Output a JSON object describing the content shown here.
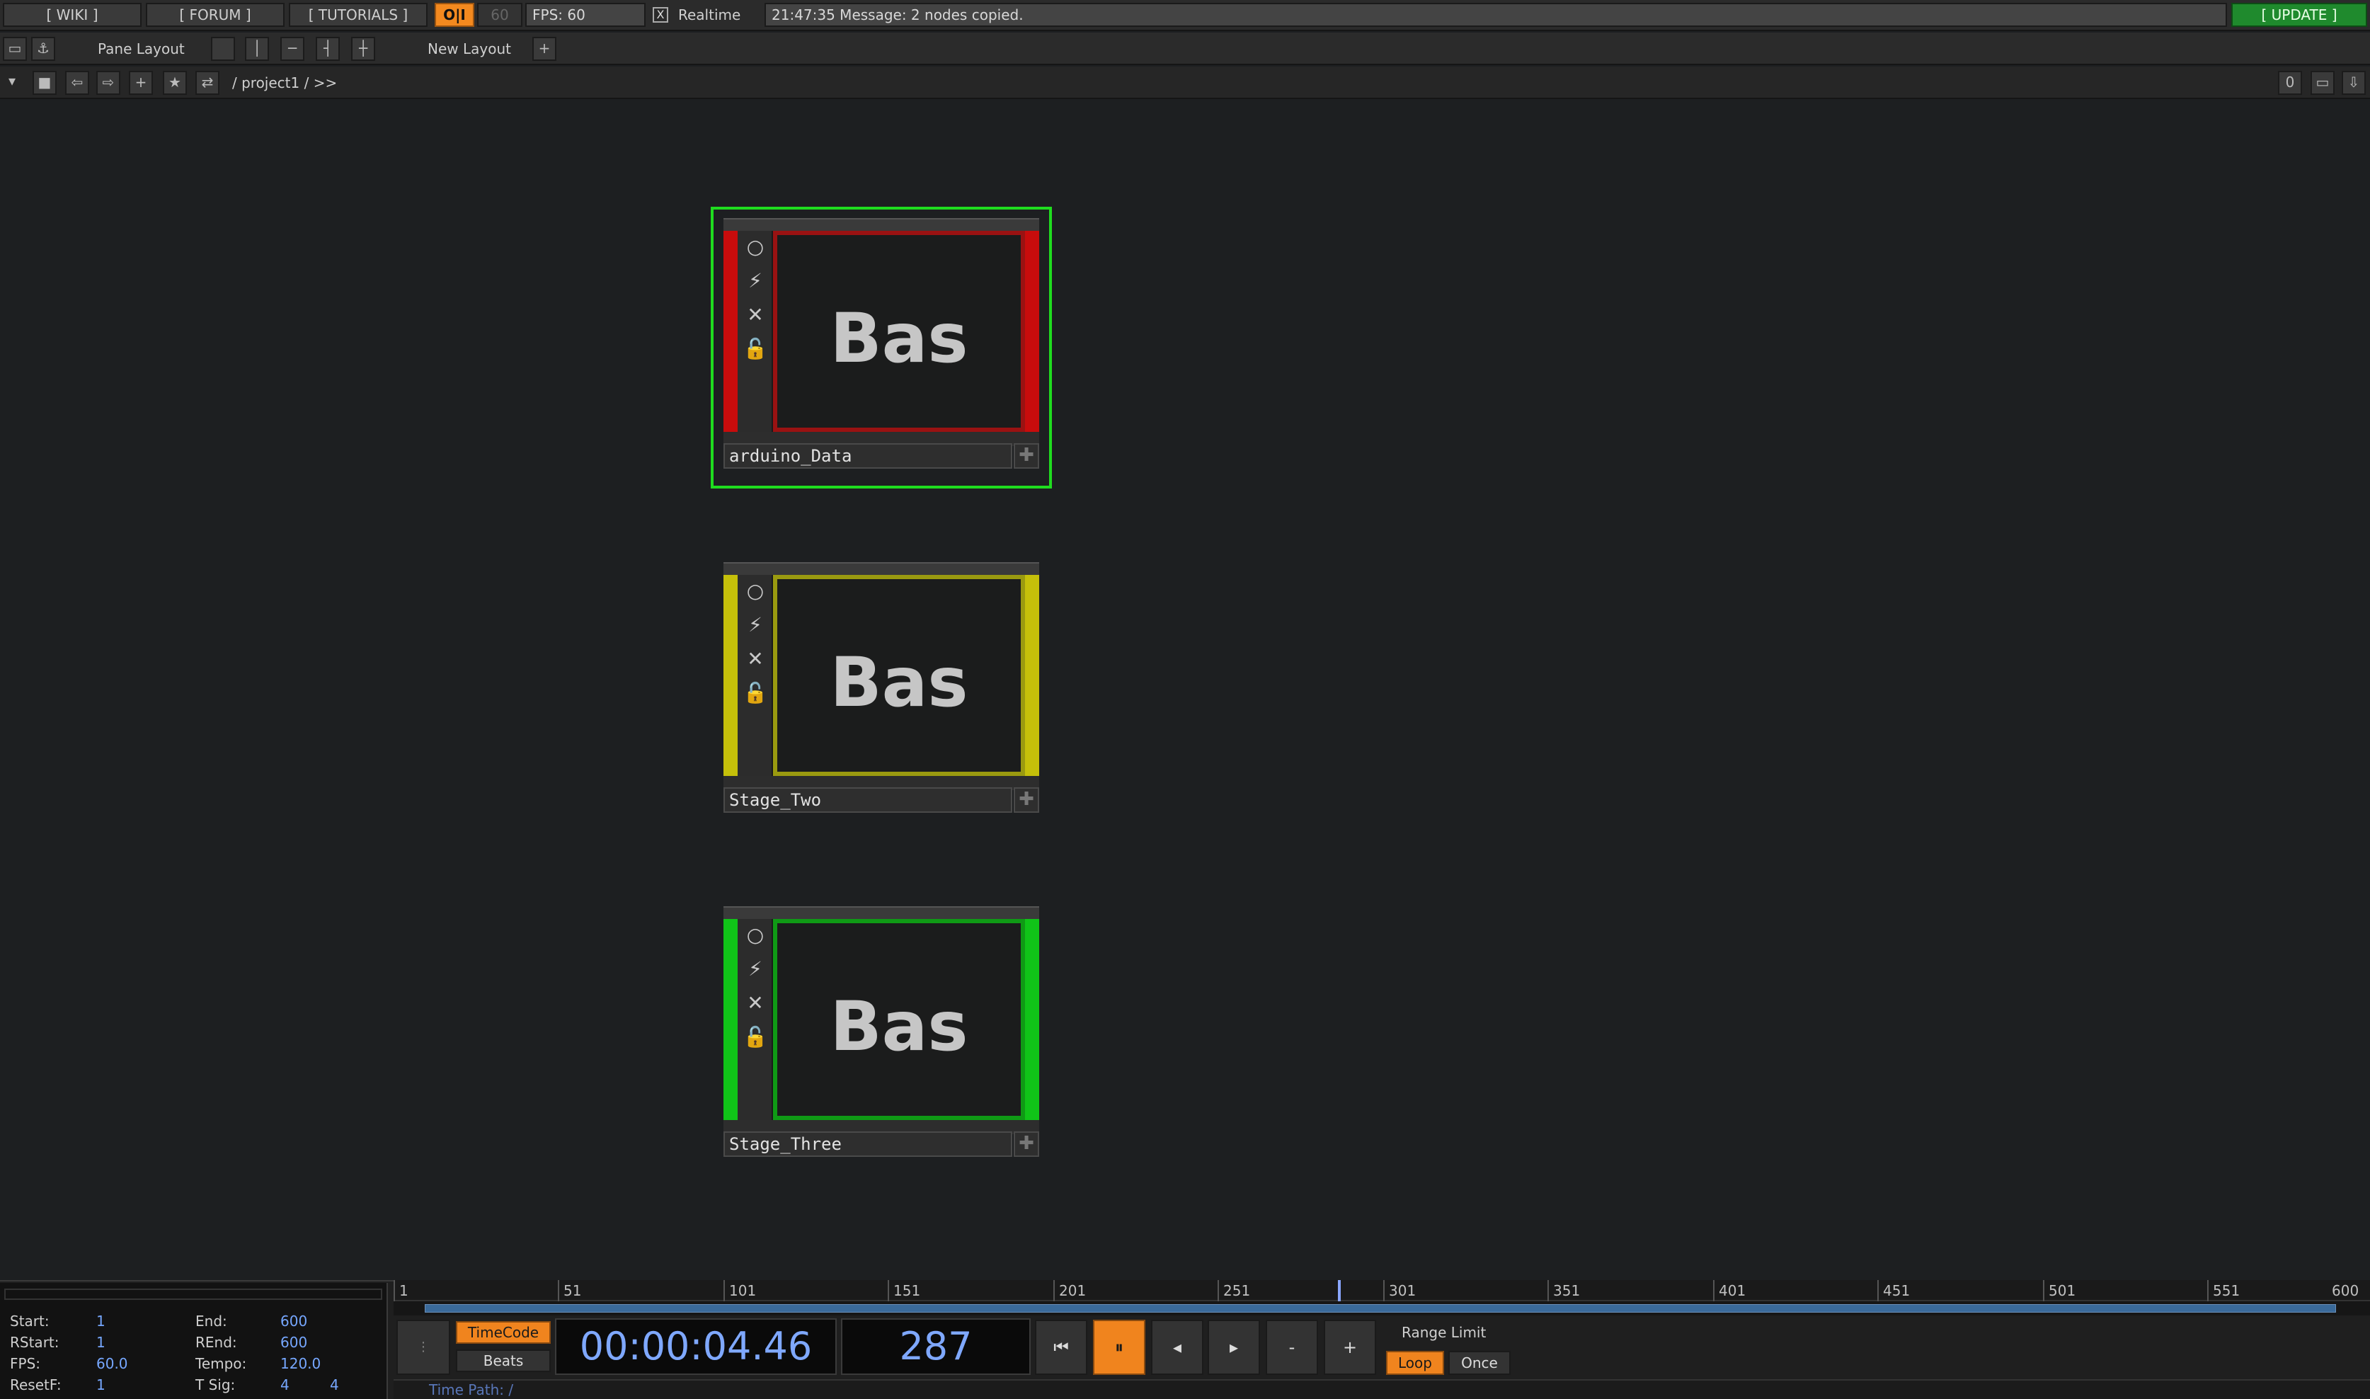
{
  "topbar": {
    "wiki": "[ WIKI ]",
    "forum": "[ FORUM ]",
    "tutorials": "[ TUTORIALS ]",
    "oi": "O|I",
    "fps_dim": "60",
    "fps_label": "FPS:  60",
    "realtime_check": "X",
    "realtime_label": "Realtime",
    "message": "21:47:35 Message: 2 nodes copied.",
    "update": "[ UPDATE ]"
  },
  "bar2": {
    "pane_layout": "Pane Layout",
    "new_layout": "New Layout",
    "add_layout": "+"
  },
  "bar3": {
    "path": "/ project1  /  >>",
    "counter": "0"
  },
  "nodes": [
    {
      "name": "arduino_Data",
      "label": "Bas",
      "color": "#c80c0c",
      "viewer_border": "#9a1212"
    },
    {
      "name": "Stage_Two",
      "label": "Bas",
      "color": "#c5c00a",
      "viewer_border": "#9a9a10"
    },
    {
      "name": "Stage_Three",
      "label": "Bas",
      "color": "#10c418",
      "viewer_border": "#0f9a15"
    }
  ],
  "range": {
    "start_label": "Start:",
    "start": "1",
    "end_label": "End:",
    "end": "600",
    "rstart_label": "RStart:",
    "rstart": "1",
    "rend_label": "REnd:",
    "rend": "600",
    "fps_label": "FPS:",
    "fps": "60.0",
    "tempo_label": "Tempo:",
    "tempo": "120.0",
    "resetf_label": "ResetF:",
    "resetf": "1",
    "tsig_label": "T Sig:",
    "tsig_a": "4",
    "tsig_b": "4"
  },
  "timeline": {
    "ticks": [
      "1",
      "51",
      "101",
      "151",
      "201",
      "251",
      "301",
      "351",
      "401",
      "451",
      "501",
      "551",
      "600"
    ],
    "timecode_btn": "TimeCode",
    "beats_btn": "Beats",
    "timecode": "00:00:04.46",
    "frame": "287",
    "minus": "-",
    "plus": "+",
    "range_limit": "Range Limit",
    "loop": "Loop",
    "once": "Once",
    "time_path": "Time Path: /"
  }
}
